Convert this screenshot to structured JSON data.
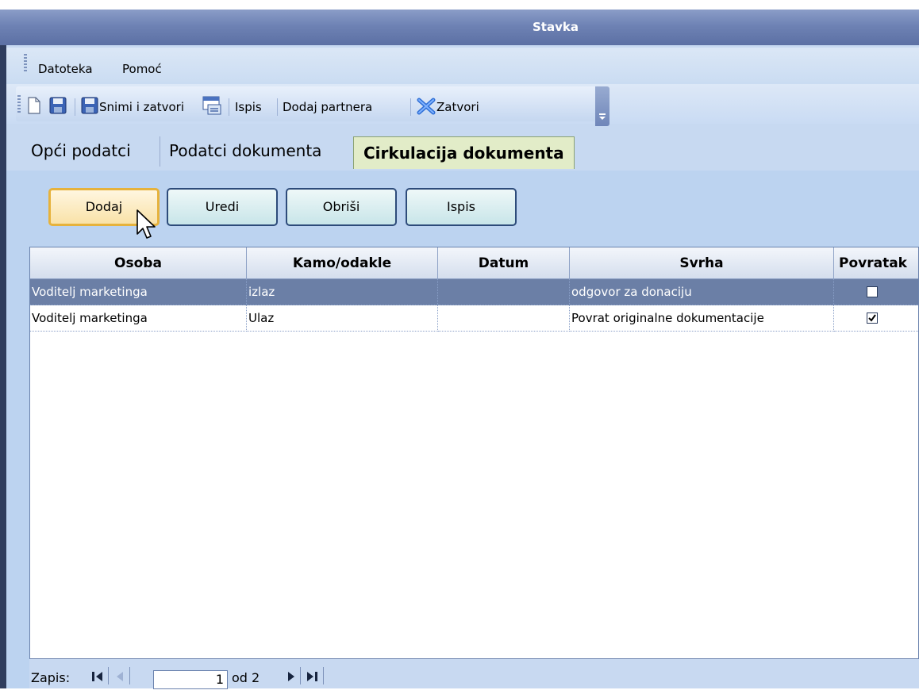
{
  "window": {
    "title": "Stavka"
  },
  "menu": {
    "items": [
      "Datoteka",
      "Pomoć"
    ]
  },
  "toolbar": {
    "save_close": "Snimi i zatvori",
    "print": "Ispis",
    "add_partner": "Dodaj partnera",
    "close": "Zatvori"
  },
  "tabs": [
    "Opći podatci",
    "Podatci dokumenta",
    "Cirkulacija dokumenta"
  ],
  "active_tab": "Cirkulacija dokumenta",
  "actions": {
    "add": "Dodaj",
    "edit": "Uredi",
    "delete": "Obriši",
    "print": "Ispis"
  },
  "grid": {
    "headers": [
      "Osoba",
      "Kamo/odakle",
      "Datum",
      "Svrha",
      "Povratak"
    ],
    "rows": [
      {
        "osoba": "Voditelj marketinga",
        "kamo": "izlaz",
        "datum": "",
        "svrha": "odgovor za donaciju",
        "povratak": false
      },
      {
        "osoba": "Voditelj marketinga",
        "kamo": "Ulaz",
        "datum": "",
        "svrha": "Povrat originalne dokumentacije",
        "povratak": true
      }
    ]
  },
  "navigator": {
    "label": "Zapis:",
    "current": "1",
    "of_text": "od 2"
  },
  "colors": {
    "title_bar": "#6e82b4",
    "selected_row": "#6b7fa6",
    "focused_button_border": "#e6b23c",
    "active_tab": "#e2ecc8"
  }
}
